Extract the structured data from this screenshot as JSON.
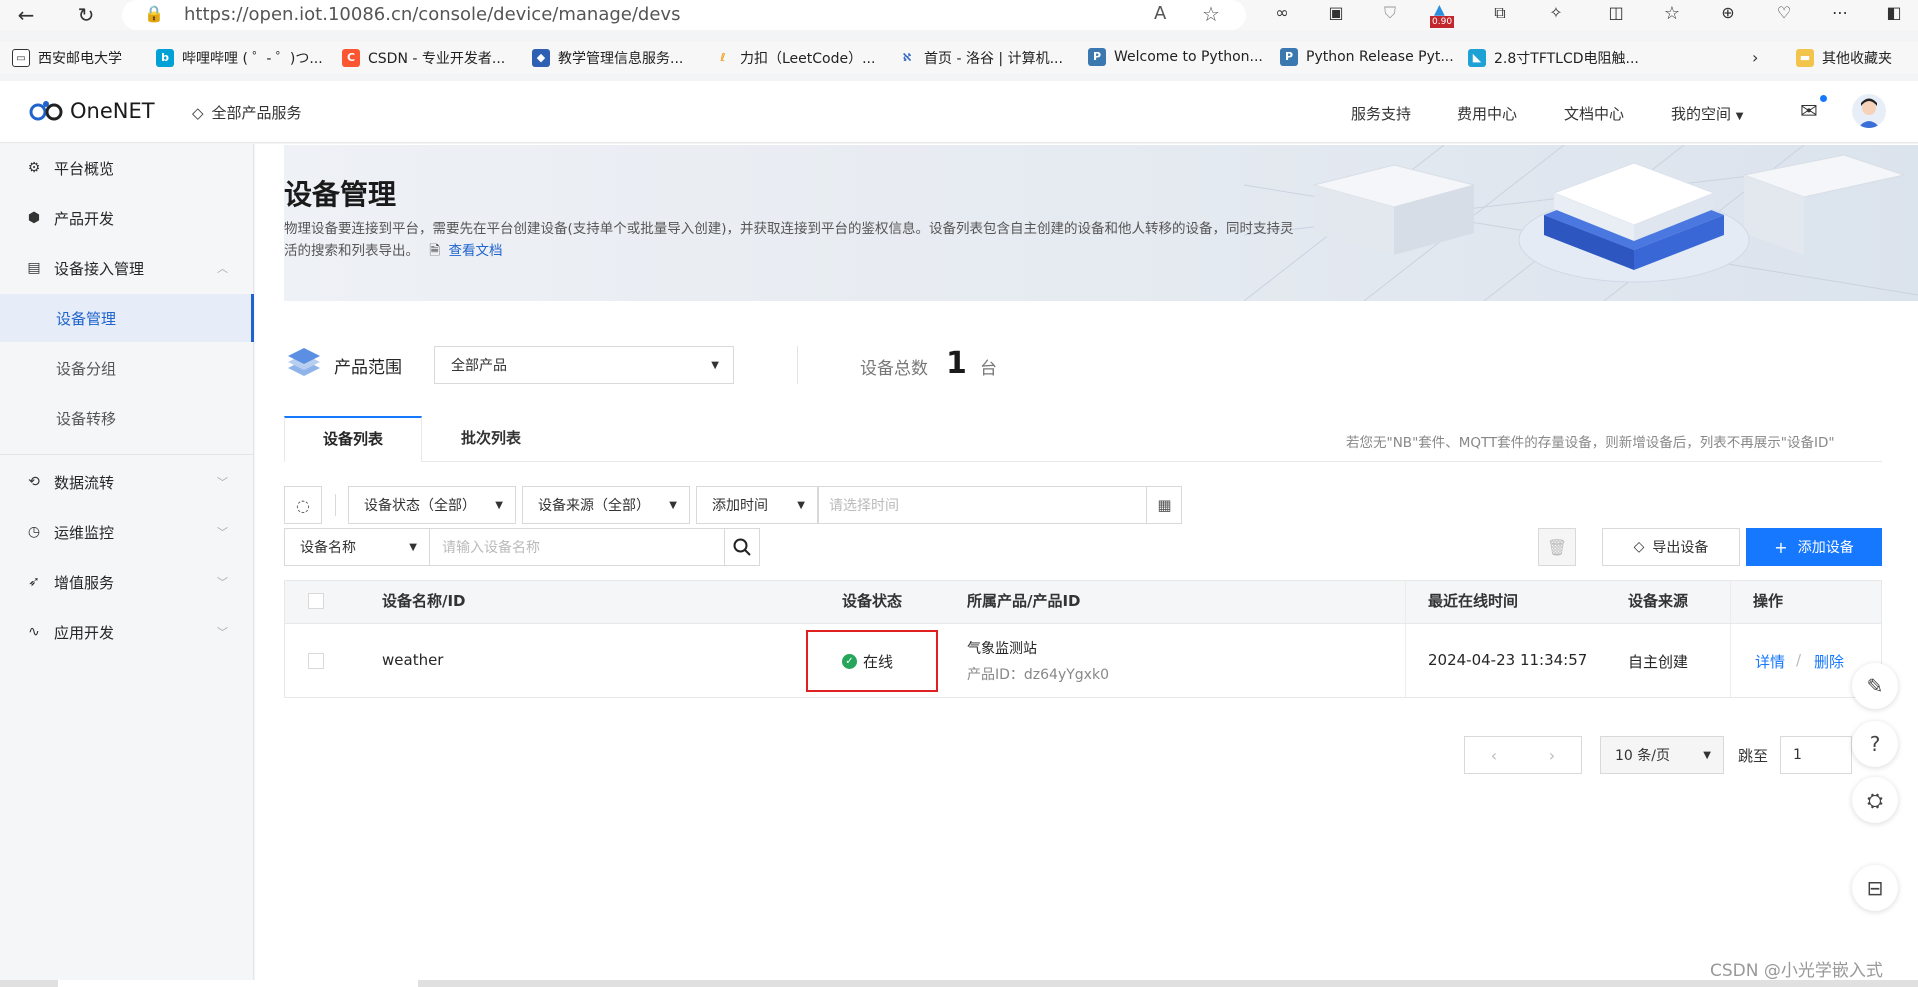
{
  "browser": {
    "url": "https://open.iot.10086.cn/console/device/manage/devs",
    "ext_badge": "0.90"
  },
  "bookmarks": [
    "西安邮电大学",
    "哔哩哔哩 ( ゜- ゜)つ...",
    "CSDN - 专业开发者...",
    "教学管理信息服务...",
    "力扣（LeetCode）...",
    "首页 - 洛谷 | 计算机...",
    "Welcome to Python...",
    "Python Release Pyt...",
    "2.8寸TFTLCD电阻触...",
    "其他收藏夹"
  ],
  "topnav": {
    "logo": "OneNET",
    "all_products": "全部产品服务",
    "links": [
      "服务支持",
      "费用中心",
      "文档中心",
      "我的空间"
    ]
  },
  "sidebar": {
    "items": [
      {
        "label": "平台概览",
        "icon": "gear-icon"
      },
      {
        "label": "产品开发",
        "icon": "cube-icon"
      },
      {
        "label": "设备接入管理",
        "icon": "device-icon"
      },
      {
        "label": "设备管理"
      },
      {
        "label": "设备分组"
      },
      {
        "label": "设备转移"
      },
      {
        "label": "数据流转",
        "icon": "flow-icon"
      },
      {
        "label": "运维监控",
        "icon": "monitor-icon"
      },
      {
        "label": "增值服务",
        "icon": "send-icon"
      },
      {
        "label": "应用开发",
        "icon": "code-icon"
      }
    ]
  },
  "banner": {
    "title": "设备管理",
    "desc_line1": "物理设备要连接到平台，需要先在平台创建设备(支持单个或批量导入创建)，并获取连接到平台的鉴权信息。设备列表包含自主创建的设备和他人转移的设备，同时支持灵",
    "desc_line2": "活的搜索和列表导出。",
    "doc_link": "查看文档"
  },
  "scope": {
    "label": "产品范围",
    "selected": "全部产品",
    "total_label": "设备总数",
    "total_value": "1",
    "total_unit": "台"
  },
  "tabs": [
    "设备列表",
    "批次列表"
  ],
  "tip": "若您无\"NB\"套件、MQTT套件的存量设备，则新增设备后，列表不再展示\"设备ID\"",
  "filters": {
    "status": "设备状态（全部）",
    "source": "设备来源（全部）",
    "time_type": "添加时间",
    "time_placeholder": "请选择时间",
    "name_type": "设备名称",
    "name_placeholder": "请输入设备名称",
    "export": "导出设备",
    "add": "添加设备"
  },
  "table": {
    "headers": [
      "设备名称/ID",
      "设备状态",
      "所属产品/产品ID",
      "最近在线时间",
      "设备来源",
      "操作"
    ],
    "rows": [
      {
        "name": "weather",
        "status": "在线",
        "product": "气象监测站",
        "product_id": "产品ID：dz64yYgxk0",
        "last_online": "2024-04-23 11:34:57",
        "source": "自主创建",
        "action_detail": "详情",
        "action_sep": "/",
        "action_delete": "删除"
      }
    ]
  },
  "pagination": {
    "per_page": "10 条/页",
    "jump_label": "跳至",
    "jump_value": "1"
  },
  "watermark": "CSDN @小光学嵌入式",
  "colors": {
    "primary": "#1677ff",
    "online": "#26a65b",
    "highlight_border": "#e02020"
  }
}
